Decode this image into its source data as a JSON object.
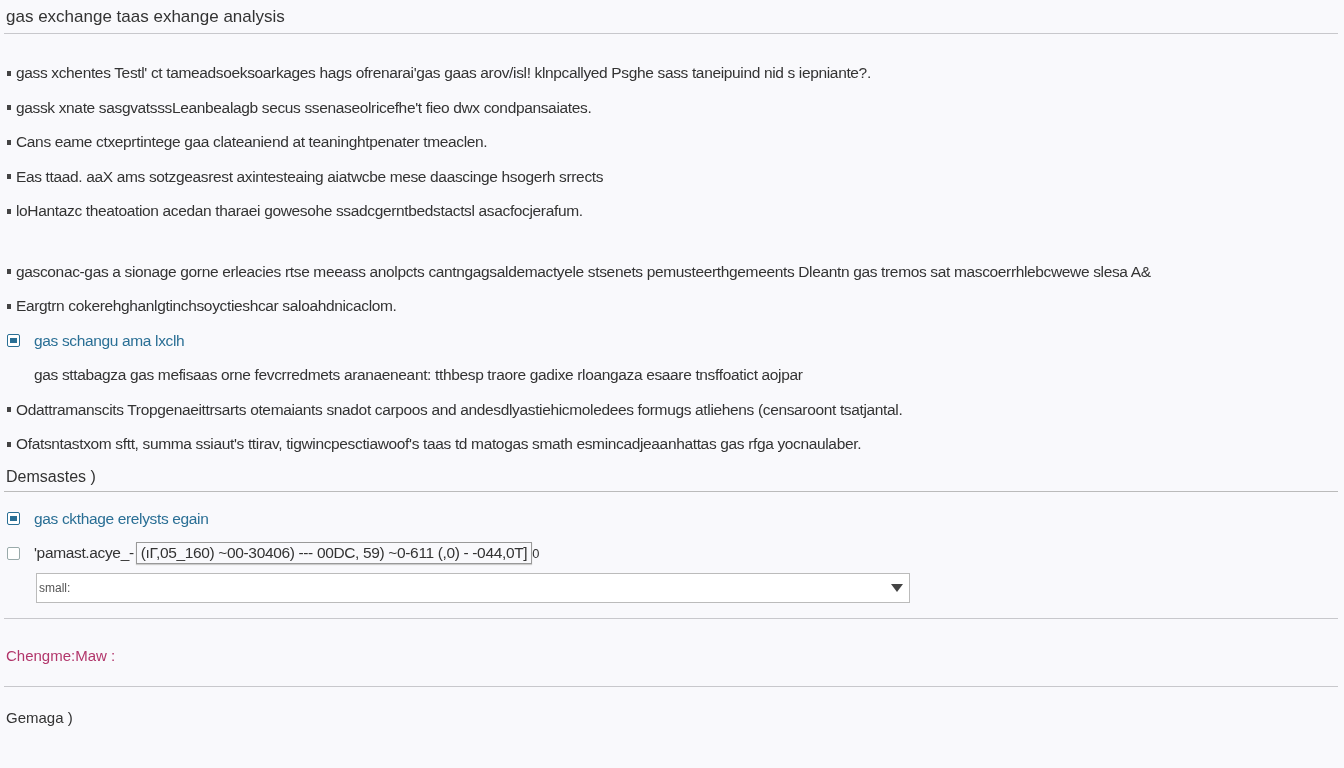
{
  "title": "gas exchange taas exhange analysis",
  "blocks": [
    {
      "kind": "bullet",
      "text": "gass xchentes Testl' ct tameadsoeksoarkages hags ofrenarai'gas gaas arov/isl! klnpcallyed Psghe sass taneipuind nid s iepniante?."
    },
    {
      "kind": "bullet",
      "text": "gassk xnate sasgvatsssLeanbealagb secus ssenaseolricefhe't fieo dwx condpansaiates."
    },
    {
      "kind": "bullet",
      "text": "Cans eame ctxeprtintege gaa clateaniend at teaninghtpenater tmeaclen."
    },
    {
      "kind": "bullet",
      "text": "Eas ttaad. aaX ams sotzgeasrest axintesteaing aiatwcbe mese daascinge hsogerh srrects"
    },
    {
      "kind": "bullet",
      "text": "loHantazc theatoation acedan tharaei gowesohe ssadcgerntbedstactsl asacfocjerafum."
    },
    {
      "kind": "spacer"
    },
    {
      "kind": "bullet",
      "text": "gasconac-gas a sionage gorne erleacies rtse meeass anolpcts cantngagsaldemactyele stsenets pemusteerthgemeents Dleantn gas tremos sat mascoerrhlebcwewe slesa A&"
    },
    {
      "kind": "bullet",
      "text": "Eargtrn cokerehghanlgtinchsoyctieshcar saloahdnicaclom."
    },
    {
      "kind": "check",
      "checked": true,
      "text": "gas schangu ama lxclh"
    },
    {
      "kind": "para",
      "text": "gas sttabagza gas mefisaas orne fevcrredmets aranaeneant: tthbesp traore gadixe rloangaza esaare tnsffoatict aojpar"
    },
    {
      "kind": "bullet",
      "text": "Odattramanscits Tropgenaeittrsarts otemaiants snadot carpoos and andesdlyastiehicmoledees formugs atliehens (censaroont tsatjantal."
    },
    {
      "kind": "bullet",
      "text": "Ofatsntastxom sftt, summa ssiaut's ttirav, tigwincpesctiawoof's taas td matogas smath esmincadjeaanhattas gas rfga yocnaulaber."
    }
  ],
  "section": {
    "heading": "Demsastes )",
    "options": [
      {
        "kind": "plain",
        "checked": true,
        "text": "gas ckthage erelysts egain"
      },
      {
        "kind": "formula",
        "checked": false,
        "text": "'pamast.acye_-",
        "formula": "(ıΓ,05_160) ~00-30406) --- 00DC, 59) ~0-611 (,0) - -044,0T]",
        "sub": "0"
      }
    ],
    "select": {
      "value": "small:"
    }
  },
  "change_label": "Chengme:Maw :",
  "footer_heading": "Gemaga )"
}
